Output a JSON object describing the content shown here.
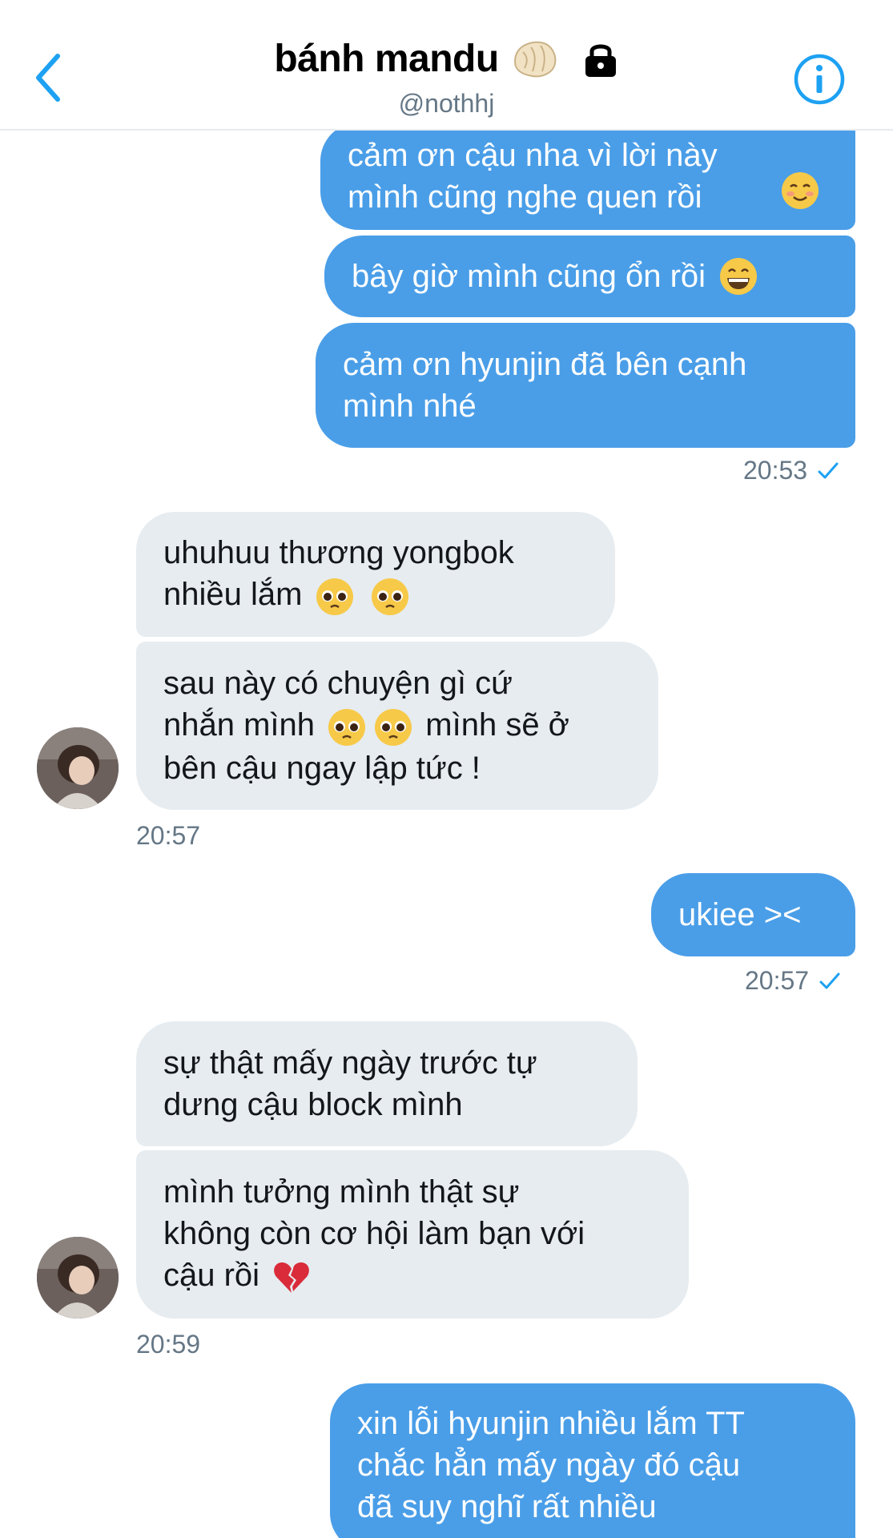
{
  "header": {
    "title": "bánh mandu",
    "handle": "@nothhj"
  },
  "messages": [
    {
      "from": "me",
      "text": "cảm ơn cậu nha vì lời này\nmình cũng nghe quen rồi",
      "emoji": "smiling-blush-emoji"
    },
    {
      "from": "me",
      "text": "bây giờ mình cũng ổn rồi",
      "emoji": "grinning-emoji"
    },
    {
      "from": "me",
      "text": "cảm ơn hyunjin đã bên cạnh\nmình nhé"
    },
    {
      "from": "them",
      "text_a": "uhuhuu thương yongbok\nnhiều lắm",
      "emoji": "pleading-face-emoji"
    },
    {
      "from": "them",
      "text_a": "sau này có chuyện gì cứ\nnhắn mình",
      "text_b": "mình sẽ ở",
      "text_c": "bên cậu ngay lập tức !",
      "emoji": "pleading-face-emoji"
    },
    {
      "from": "me",
      "text": "ukiee ><"
    },
    {
      "from": "them",
      "text": "sự thật mấy ngày trước tự\ndưng cậu block mình"
    },
    {
      "from": "them",
      "text_a": "mình tưởng mình thật sự\nkhông còn cơ hội làm bạn với\ncậu rồi",
      "emoji": "broken-heart-emoji"
    },
    {
      "from": "me",
      "text": "xin lỗi hyunjin nhiều lắm TT\nchắc hẳn mấy ngày đó cậu\nđã suy nghĩ rất nhiều"
    }
  ],
  "timestamps": {
    "t1": "20:53",
    "t2": "20:57",
    "t3": "20:57",
    "t4": "20:59"
  },
  "colors": {
    "accent": "#1da1f2",
    "me_bubble": "#4a9ee8",
    "them_bubble": "#e6ecf0",
    "muted": "#657786"
  }
}
